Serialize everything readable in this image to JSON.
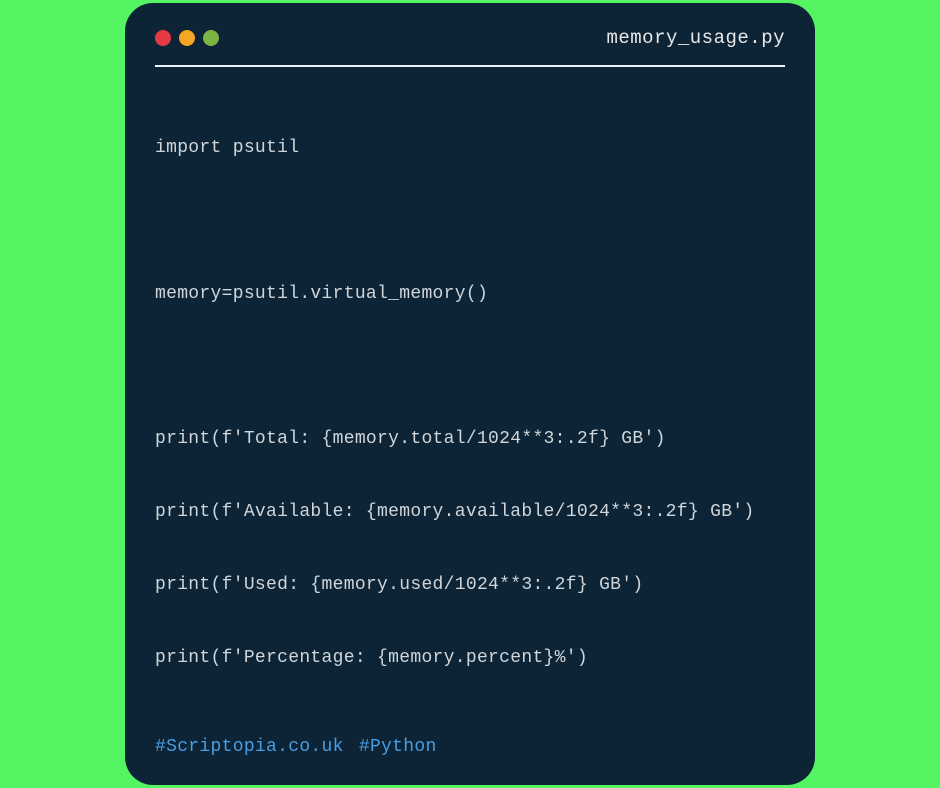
{
  "window": {
    "filename": "memory_usage.py"
  },
  "code": {
    "lines": [
      "import psutil",
      "",
      "memory=psutil.virtual_memory()",
      "",
      "print(f'Total: {memory.total/1024**3:.2f} GB')",
      "print(f'Available: {memory.available/1024**3:.2f} GB')",
      "print(f'Used: {memory.used/1024**3:.2f} GB')",
      "print(f'Percentage: {memory.percent}%')"
    ]
  },
  "hashtags": {
    "tag1": "#Scriptopia.co.uk",
    "tag2": "#Python"
  }
}
